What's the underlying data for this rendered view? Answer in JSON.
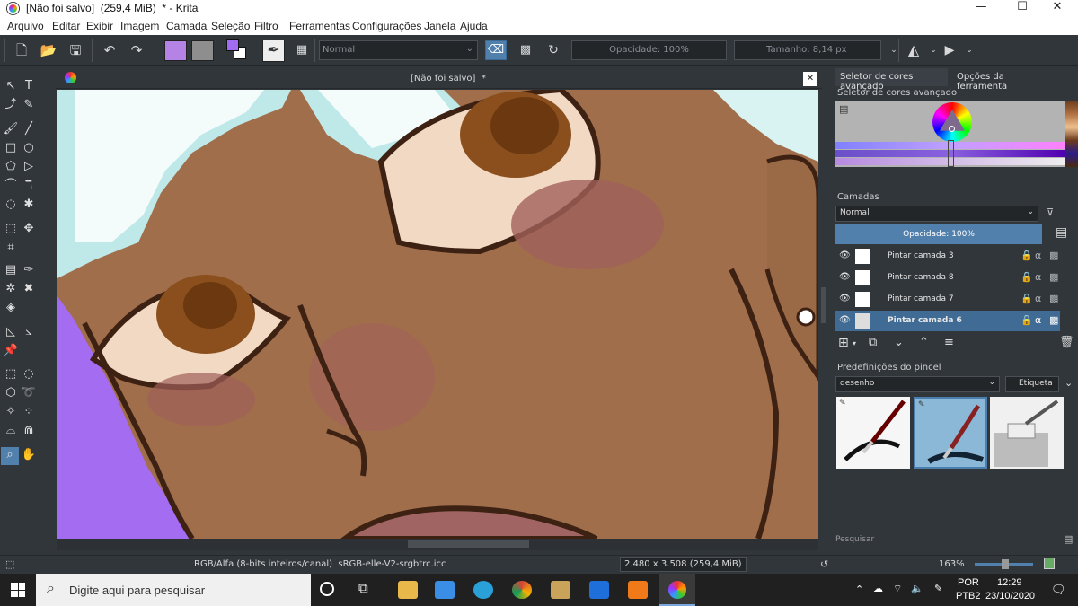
{
  "window": {
    "title": "[Não foi salvo]  (259,4 MiB)  * - Krita",
    "controls": {
      "minimize": "—",
      "maximize": "☐",
      "close": "✕"
    }
  },
  "menu": [
    "Arquivo",
    "Editar",
    "Exibir",
    "Imagem",
    "Camada",
    "Seleção",
    "Filtro",
    "Ferramentas",
    "Configurações",
    "Janela",
    "Ajuda"
  ],
  "toolbar": {
    "blend_mode": "Normal",
    "opacity": "Opacidade: 100%",
    "size": "Tamanho: 8,14 px",
    "fg_color": "#b583e6",
    "bg_color": "#8e8e8e"
  },
  "document": {
    "tab_title": "[Não foi salvo]  *",
    "close": "✕"
  },
  "dock": {
    "tabs": [
      "Seletor de cores avançado",
      "Opções da ferramenta"
    ],
    "color_selector_title": "Seletor de cores avançado",
    "layers_title": "Camadas",
    "layers_blend": "Normal",
    "layers_opacity": "Opacidade:  100%",
    "layers": [
      {
        "name": "Pintar camada 3",
        "selected": false
      },
      {
        "name": "Pintar camada 8",
        "selected": false
      },
      {
        "name": "Pintar camada 7",
        "selected": false
      },
      {
        "name": "Pintar camada 6",
        "selected": true
      }
    ],
    "presets_title": "Predefinições do pincel",
    "preset_tag": "desenho",
    "tag_button": "Etiqueta",
    "search_placeholder": "Pesquisar"
  },
  "status": {
    "color_profile": "RGB/Alfa (8-bits inteiros/canal)  sRGB-elle-V2-srgbtrc.icc",
    "dimensions": "2.480 x 3.508 (259,4 MiB)",
    "zoom": "163%"
  },
  "taskbar": {
    "search_placeholder": "Digite aqui para pesquisar",
    "lang": "POR",
    "layout": "PTB2",
    "time": "12:29",
    "date": "23/10/2020"
  }
}
